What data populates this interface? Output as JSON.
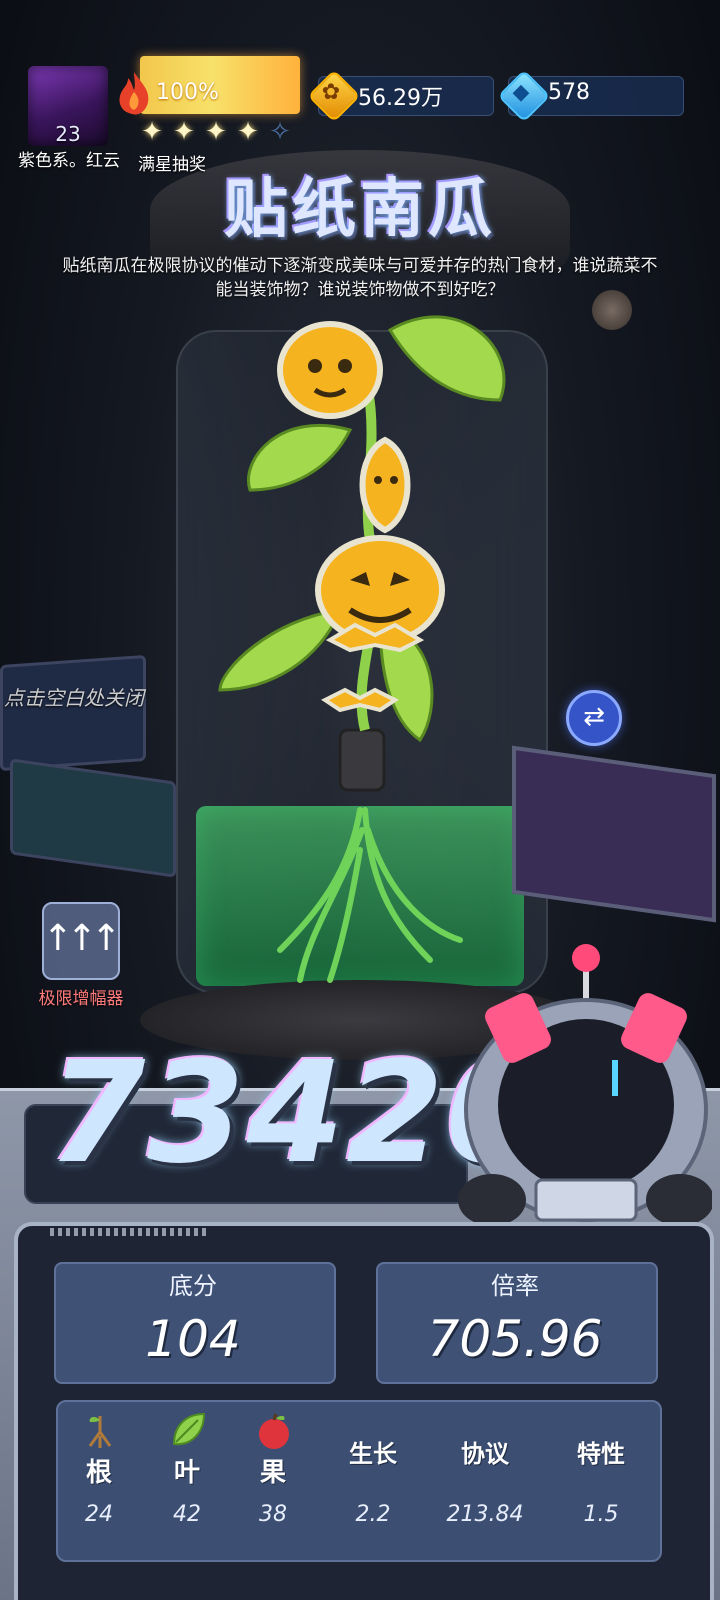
{
  "player": {
    "level": "23",
    "name": "紫色系。红云"
  },
  "energy": {
    "percent_label": "100%",
    "stars_filled": 4,
    "stars_total": 5,
    "draw_label": "满星抽奖"
  },
  "currency": {
    "coins": "56.29万",
    "gems": "578"
  },
  "item": {
    "title": "贴纸南瓜",
    "description": "贴纸南瓜在极限协议的催动下逐渐变成美味与可爱并存的热门食材，谁说蔬菜不能当装饰物？谁说装饰物做不到好吃？"
  },
  "hints": {
    "close_hint": "点击空白处关闭",
    "amplifier_label": "极限增幅器"
  },
  "score": {
    "total": "73420",
    "base_label": "底分",
    "base_value": "104",
    "multiplier_label": "倍率",
    "multiplier_value": "705.96"
  },
  "attributes": {
    "root": {
      "label": "根",
      "value": "24"
    },
    "leaf": {
      "label": "叶",
      "value": "42"
    },
    "fruit": {
      "label": "果",
      "value": "38"
    },
    "growth": {
      "label": "生长",
      "value": "2.2"
    },
    "protocol": {
      "label": "协议",
      "value": "213.84"
    },
    "trait": {
      "label": "特性",
      "value": "1.5"
    }
  },
  "colors": {
    "energy_bar": "#f7e16a",
    "amplifier_label": "#ff7a7a",
    "stat_card": "#3f5275",
    "swap_button": "#3454c8"
  }
}
